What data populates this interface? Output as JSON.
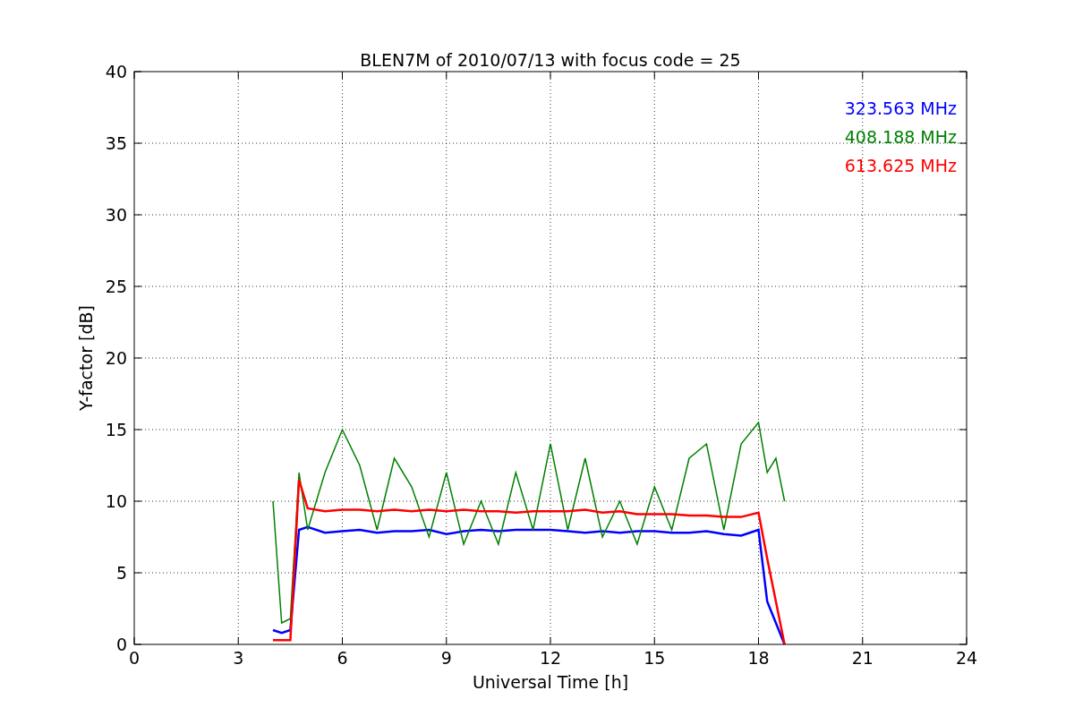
{
  "figure": {
    "chart_data": {
      "type": "line",
      "title": "BLEN7M of 2010/07/13 with focus code = 25",
      "xlabel": "Universal Time [h]",
      "ylabel": "Y-factor [dB]",
      "x": [
        4.0,
        4.25,
        4.5,
        4.75,
        5.0,
        5.5,
        6.0,
        6.5,
        7.0,
        7.5,
        8.0,
        8.5,
        9.0,
        9.5,
        10.0,
        10.5,
        11.0,
        11.5,
        12.0,
        12.5,
        13.0,
        13.5,
        14.0,
        14.5,
        15.0,
        15.5,
        16.0,
        16.5,
        17.0,
        17.5,
        18.0,
        18.25,
        18.5,
        18.75
      ],
      "series": [
        {
          "name": "323.563 MHz",
          "color": "#0000ff",
          "values": [
            1.0,
            0.8,
            1.0,
            8.0,
            8.2,
            7.8,
            7.9,
            8.0,
            7.8,
            7.9,
            7.9,
            8.0,
            7.7,
            7.9,
            8.0,
            7.9,
            8.0,
            8.0,
            8.0,
            7.9,
            7.8,
            7.9,
            7.8,
            7.9,
            7.9,
            7.8,
            7.8,
            7.9,
            7.7,
            7.6,
            8.0,
            3.0,
            1.5,
            0
          ]
        },
        {
          "name": "408.188 MHz",
          "color": "#008000",
          "values": [
            10.0,
            1.5,
            1.8,
            12.0,
            8.0,
            12.0,
            15.0,
            12.5,
            8.0,
            13.0,
            11.0,
            7.5,
            12.0,
            7.0,
            10.0,
            7.0,
            12.0,
            8.0,
            14.0,
            8.0,
            13.0,
            7.5,
            10.0,
            7.0,
            11.0,
            8.0,
            13.0,
            14.0,
            8.0,
            14.0,
            15.5,
            12.0,
            13.0,
            10.0
          ]
        },
        {
          "name": "613.625 MHz",
          "color": "#ff0000",
          "values": [
            0.3,
            0.3,
            0.3,
            11.5,
            9.5,
            9.3,
            9.4,
            9.4,
            9.3,
            9.4,
            9.3,
            9.4,
            9.3,
            9.4,
            9.3,
            9.3,
            9.2,
            9.3,
            9.3,
            9.3,
            9.4,
            9.2,
            9.3,
            9.1,
            9.1,
            9.1,
            9.0,
            9.0,
            8.9,
            8.9,
            9.2,
            6.0,
            3.0,
            0
          ]
        }
      ],
      "grid": true,
      "xlim": [
        0,
        24
      ],
      "ylim": [
        0,
        40
      ],
      "xticks": [
        0,
        3,
        6,
        9,
        12,
        15,
        18,
        21,
        24
      ],
      "yticks": [
        0,
        5,
        10,
        15,
        20,
        25,
        30,
        35,
        40
      ]
    }
  }
}
